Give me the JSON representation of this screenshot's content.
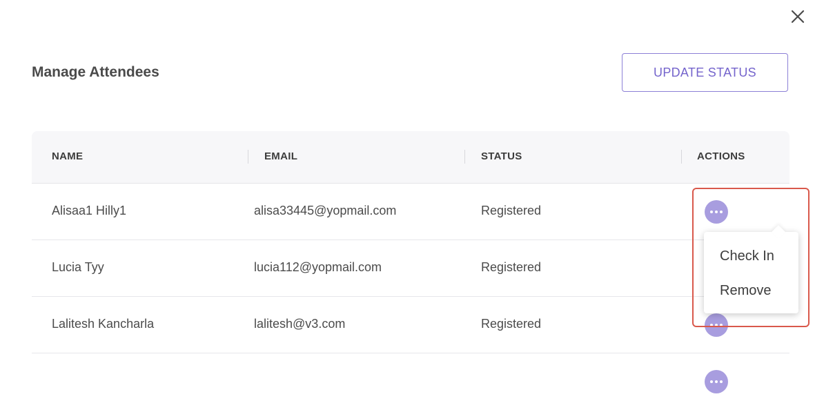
{
  "dialog": {
    "close_icon": "close-icon",
    "title": "Manage Attendees",
    "update_button_label": "UPDATE STATUS"
  },
  "table": {
    "columns": [
      "NAME",
      "EMAIL",
      "STATUS",
      "ACTIONS"
    ],
    "rows": [
      {
        "name": "Alisaa1 Hilly1",
        "email": "alisa33445@yopmail.com",
        "status": "Registered"
      },
      {
        "name": "Lucia Tyy",
        "email": "lucia112@yopmail.com",
        "status": "Registered"
      },
      {
        "name": "Lalitesh Kancharla",
        "email": "lalitesh@v3.com",
        "status": "Registered"
      },
      {
        "name": "",
        "email": "",
        "status": ""
      }
    ]
  },
  "actions_menu": {
    "items": [
      "Check In",
      "Remove"
    ]
  },
  "colors": {
    "accent": "#7464cc",
    "actions_button": "#a89ddf",
    "highlight": "#d9584b"
  }
}
